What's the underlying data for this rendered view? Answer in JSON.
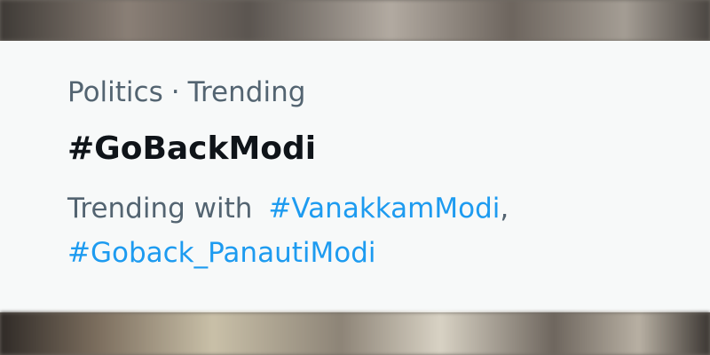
{
  "trend": {
    "category": "Politics",
    "separator": "·",
    "status": "Trending",
    "title": "#GoBackModi",
    "trending_with_label": "Trending with",
    "related_hashtags": [
      "#VanakkamModi",
      "#Goback_PanautiModi"
    ],
    "related_separator": ","
  },
  "colors": {
    "card_background": "#f7f9f9",
    "secondary_text": "#536471",
    "primary_text": "#0f1419",
    "link": "#1d9bf0"
  }
}
